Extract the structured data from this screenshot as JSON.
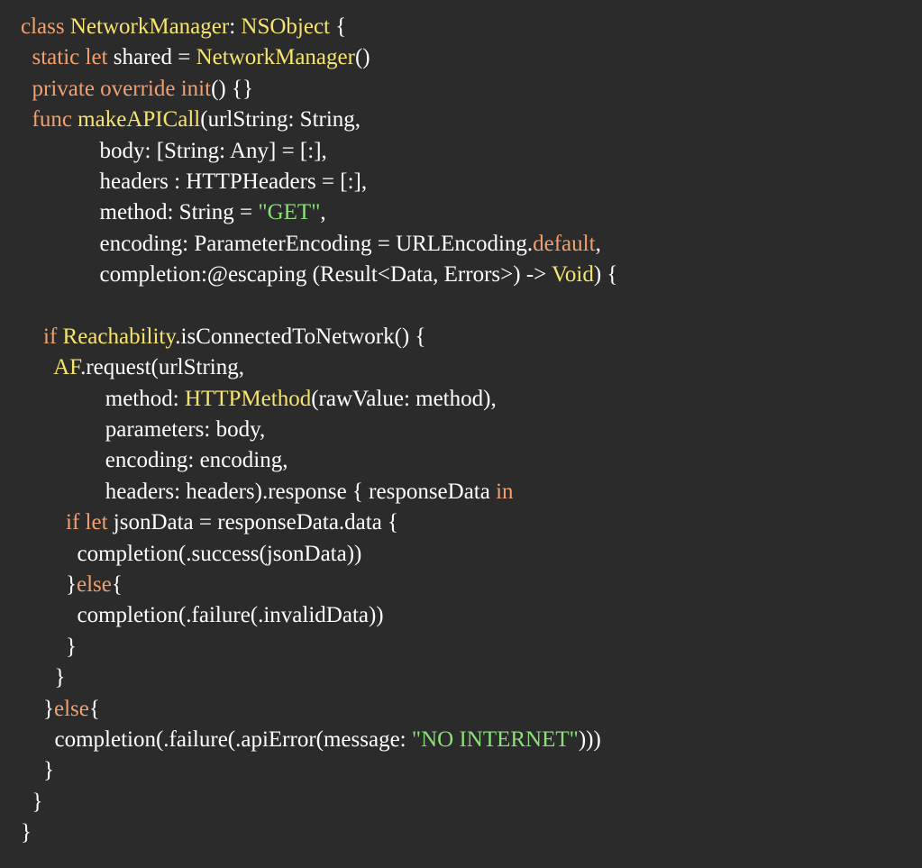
{
  "colors": {
    "background": "#2b2b2b",
    "plain": "#ffffff",
    "keyword": "#f0a070",
    "type": "#f7e46e",
    "string": "#8be07a"
  },
  "code": {
    "lines": [
      [
        [
          "kw",
          "class"
        ],
        [
          "pl",
          " "
        ],
        [
          "ty",
          "NetworkManager"
        ],
        [
          "pl",
          ": "
        ],
        [
          "ty",
          "NSObject"
        ],
        [
          "pl",
          " {"
        ]
      ],
      [
        [
          "pl",
          "  "
        ],
        [
          "kw",
          "static"
        ],
        [
          "pl",
          " "
        ],
        [
          "kw",
          "let"
        ],
        [
          "pl",
          " shared = "
        ],
        [
          "ty",
          "NetworkManager"
        ],
        [
          "pl",
          "()"
        ]
      ],
      [
        [
          "pl",
          "  "
        ],
        [
          "kw",
          "private"
        ],
        [
          "pl",
          " "
        ],
        [
          "kw",
          "override"
        ],
        [
          "pl",
          " "
        ],
        [
          "kw",
          "init"
        ],
        [
          "pl",
          "() {}"
        ]
      ],
      [
        [
          "pl",
          "  "
        ],
        [
          "kw",
          "func"
        ],
        [
          "pl",
          " "
        ],
        [
          "ty",
          "makeAPICall"
        ],
        [
          "pl",
          "(urlString: String,"
        ]
      ],
      [
        [
          "pl",
          "              body: [String: Any] = [:],"
        ]
      ],
      [
        [
          "pl",
          "              headers : HTTPHeaders = [:],"
        ]
      ],
      [
        [
          "pl",
          "              method: String = "
        ],
        [
          "str",
          "\"GET\""
        ],
        [
          "pl",
          ","
        ]
      ],
      [
        [
          "pl",
          "              encoding: ParameterEncoding = URLEncoding."
        ],
        [
          "kw",
          "default"
        ],
        [
          "pl",
          ","
        ]
      ],
      [
        [
          "pl",
          "              completion:@escaping (Result<Data, Errors>) -> "
        ],
        [
          "ty",
          "Void"
        ],
        [
          "pl",
          ") {"
        ]
      ],
      [
        [
          "pl",
          " "
        ]
      ],
      [
        [
          "pl",
          "    "
        ],
        [
          "kw",
          "if"
        ],
        [
          "pl",
          " "
        ],
        [
          "ty",
          "Reachability"
        ],
        [
          "pl",
          ".isConnectedToNetwork() {"
        ]
      ],
      [
        [
          "pl",
          "      "
        ],
        [
          "ty",
          "AF"
        ],
        [
          "pl",
          ".request(urlString,"
        ]
      ],
      [
        [
          "pl",
          "               method: "
        ],
        [
          "ty",
          "HTTPMethod"
        ],
        [
          "pl",
          "(rawValue: method),"
        ]
      ],
      [
        [
          "pl",
          "               parameters: body,"
        ]
      ],
      [
        [
          "pl",
          "               encoding: encoding,"
        ]
      ],
      [
        [
          "pl",
          "               headers: headers).response { responseData "
        ],
        [
          "kw",
          "in"
        ]
      ],
      [
        [
          "pl",
          "        "
        ],
        [
          "kw",
          "if"
        ],
        [
          "pl",
          " "
        ],
        [
          "kw",
          "let"
        ],
        [
          "pl",
          " jsonData = responseData.data {"
        ]
      ],
      [
        [
          "pl",
          "          completion(.success(jsonData))"
        ]
      ],
      [
        [
          "pl",
          "        }"
        ],
        [
          "kw",
          "else"
        ],
        [
          "pl",
          "{"
        ]
      ],
      [
        [
          "pl",
          "          completion(.failure(.invalidData))"
        ]
      ],
      [
        [
          "pl",
          "        }"
        ]
      ],
      [
        [
          "pl",
          "      }"
        ]
      ],
      [
        [
          "pl",
          "    }"
        ],
        [
          "kw",
          "else"
        ],
        [
          "pl",
          "{"
        ]
      ],
      [
        [
          "pl",
          "      completion(.failure(.apiError(message: "
        ],
        [
          "str",
          "\"NO INTERNET\""
        ],
        [
          "pl",
          ")))"
        ]
      ],
      [
        [
          "pl",
          "    }"
        ]
      ],
      [
        [
          "pl",
          "  }"
        ]
      ],
      [
        [
          "pl",
          "}"
        ]
      ]
    ]
  }
}
